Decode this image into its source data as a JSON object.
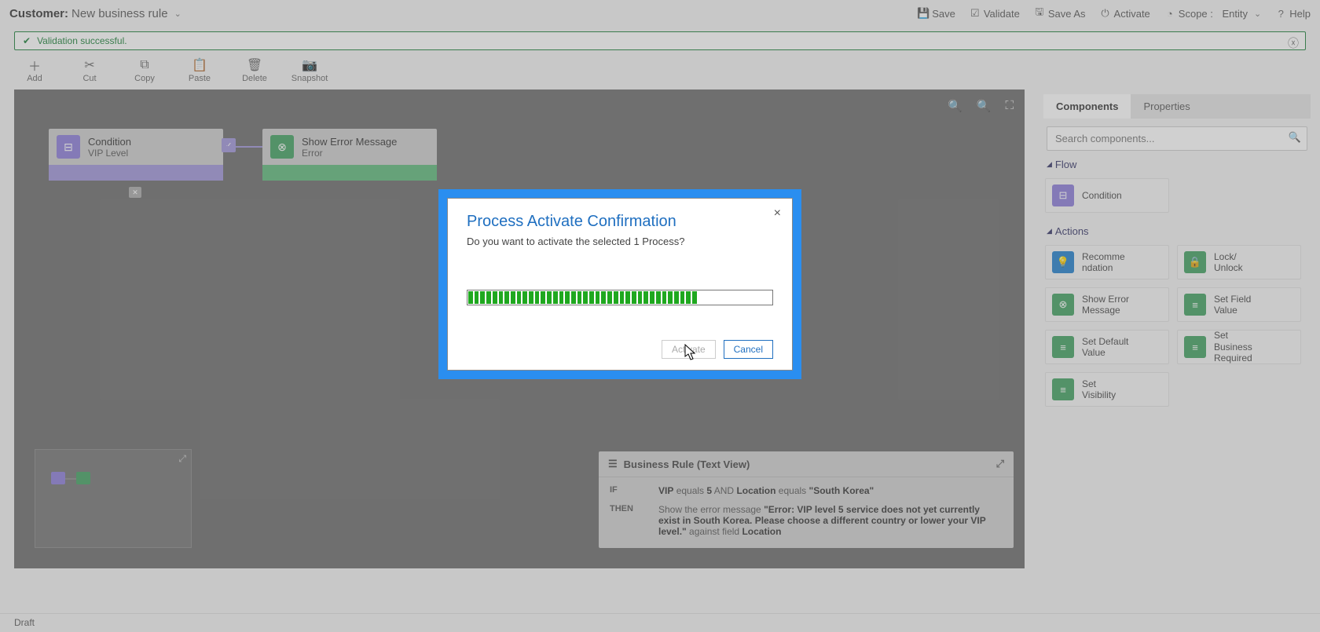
{
  "breadcrumb": {
    "entity": "Customer:",
    "name": "New business rule"
  },
  "topActions": {
    "save": "Save",
    "validate": "Validate",
    "saveAs": "Save As",
    "activate": "Activate",
    "scope": "Scope :",
    "scopeValue": "Entity",
    "help": "Help"
  },
  "validation": {
    "message": "Validation successful."
  },
  "toolbar": {
    "add": "Add",
    "cut": "Cut",
    "copy": "Copy",
    "paste": "Paste",
    "delete": "Delete",
    "snapshot": "Snapshot"
  },
  "canvas": {
    "condition": {
      "title": "Condition",
      "subtitle": "VIP Level"
    },
    "error": {
      "title": "Show Error Message",
      "subtitle": "Error"
    }
  },
  "textView": {
    "title": "Business Rule (Text View)",
    "ifKey": "IF",
    "thenKey": "THEN",
    "ifLine": {
      "field1": "VIP",
      "op1": "equals",
      "val1": "5",
      "and": "AND",
      "field2": "Location",
      "op2": "equals",
      "val2": "\"South Korea\""
    },
    "thenPrefix": "Show the error message ",
    "thenMsg": "\"Error: VIP level 5 service does not yet currently exist in South Korea. Please choose a different country or lower your VIP level.\"",
    "thenMid": " against field ",
    "thenField": "Location"
  },
  "rightPanel": {
    "tabs": {
      "components": "Components",
      "properties": "Properties"
    },
    "searchPlaceholder": "Search components...",
    "sections": {
      "flow": "Flow",
      "actions": "Actions"
    },
    "flowItems": {
      "condition": "Condition"
    },
    "actionItems": {
      "recommend": "Recomme\nndation",
      "lock": "Lock/\nUnlock",
      "showError": "Show Error\nMessage",
      "setField": "Set Field\nValue",
      "setDefault": "Set Default\nValue",
      "setReq": "Set\nBusiness\nRequired",
      "setVis": "Set\nVisibility"
    }
  },
  "status": "Draft",
  "dialog": {
    "title": "Process Activate Confirmation",
    "message": "Do you want to activate the selected 1 Process?",
    "activate": "Activate",
    "cancel": "Cancel"
  }
}
